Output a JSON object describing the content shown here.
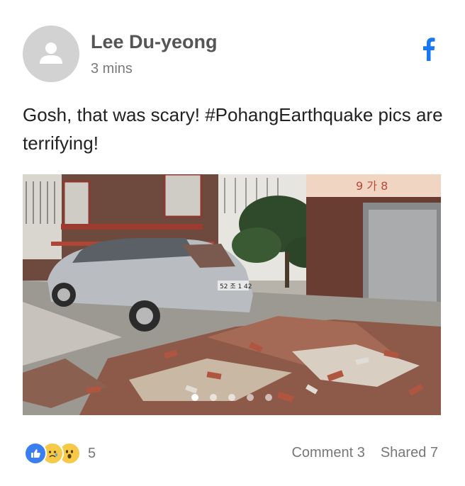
{
  "post": {
    "author": "Lee Du-yeong",
    "time": "3 mins",
    "text": "Gosh, that was scary! #PohangEarthquake pics are terrifying!",
    "network_icon": "facebook-icon",
    "brand_color": "#1877f2"
  },
  "photo": {
    "sign_text": "9 가 8",
    "plate_text": "52 조 1 42",
    "slide_count": 5,
    "active_slide": 1
  },
  "footer": {
    "reactions": [
      "like-icon",
      "sad-icon",
      "wow-icon"
    ],
    "reaction_count": "5",
    "comment_label": "Comment 3",
    "shared_label": "Shared 7"
  }
}
